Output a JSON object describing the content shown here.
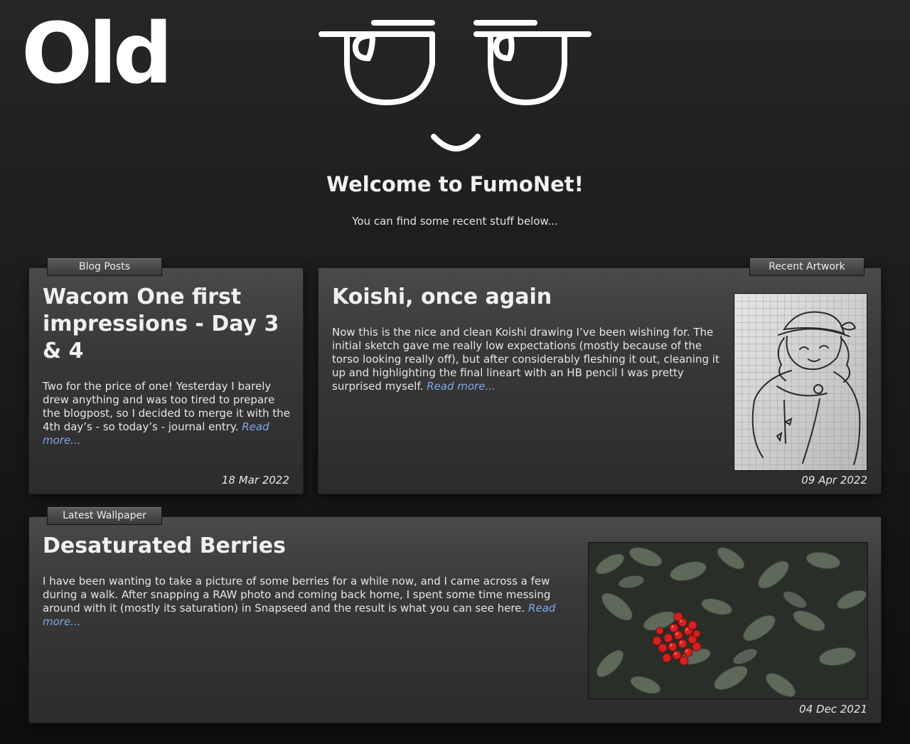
{
  "header": {
    "old_label": "Old",
    "welcome_title": "Welcome to FumoNet!",
    "welcome_subtitle": "You can find some recent stuff below..."
  },
  "blog": {
    "tab_label": "Blog Posts",
    "title": "Wacom One first impressions - Day 3 & 4",
    "body": "Two for the price of one! Yesterday I barely drew anything and was too tired to prepare the blogpost, so I decided to merge it with the 4th day’s - so today’s - journal entry.",
    "read_more": "Read more...",
    "date": "18 Mar 2022"
  },
  "artwork": {
    "tab_label": "Recent Artwork",
    "title": "Koishi, once again",
    "body": "Now this is the nice and clean Koishi drawing I’ve been wishing for. The initial sketch gave me really low expectations (mostly because of the torso looking really off), but after considerably fleshing it out, cleaning it up and highlighting the final lineart with an HB pencil I was pretty surprised myself.",
    "read_more": "Read more...",
    "date": "09 Apr 2022",
    "image_icon": "pencil-sketch-image"
  },
  "wallpaper": {
    "tab_label": "Latest Wallpaper",
    "title": "Desaturated Berries",
    "body": "I have been wanting to take a picture of some berries for a while now, and I came across a few during a walk. After snapping a RAW photo and coming back home, I spent some time messing around with it (mostly its saturation) in Snapseed and the result is what you can see here.",
    "read_more": "Read more...",
    "date": "04 Dec 2021",
    "image_icon": "berries-photo"
  },
  "colors": {
    "link": "#7fa8e6",
    "background": "#1b1b1b",
    "panel": "#3a3a3a",
    "berry_red": "#d4201e"
  }
}
